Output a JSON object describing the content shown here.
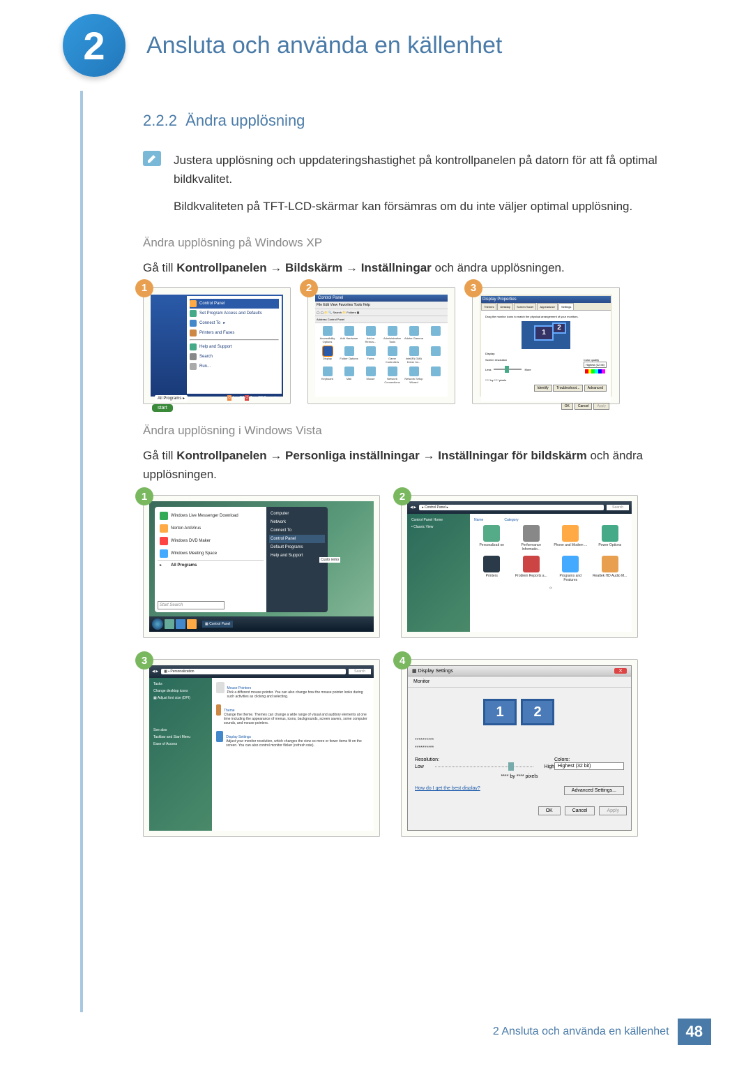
{
  "chapter": {
    "number": "2",
    "title": "Ansluta och använda en källenhet"
  },
  "section": {
    "number": "2.2.2",
    "title": "Ändra upplösning"
  },
  "intro": {
    "p1": "Justera upplösning och uppdateringshastighet på kontrollpanelen på datorn för att få optimal bildkvalitet.",
    "p2": "Bildkvaliteten på TFT-LCD-skärmar kan försämras om du inte väljer optimal upplösning."
  },
  "xp": {
    "heading": "Ändra upplösning på Windows XP",
    "path_pre": "Gå till ",
    "path_b1": "Kontrollpanelen",
    "path_b2": "Bildskärm",
    "path_b3": "Inställningar",
    "path_post": " och ändra upplösningen.",
    "menu": {
      "title": "Control Panel",
      "items": [
        "Set Program Access and Defaults",
        "Connect To",
        "Printers and Faxes",
        "Help and Support",
        "Search",
        "Run..."
      ],
      "all_programs": "All Programs",
      "logoff": "Log Off",
      "shutdown": "Turn Off Computer",
      "start": "start"
    },
    "cp": {
      "title": "Control Panel",
      "menus": "File  Edit  View  Favorites  Tools  Help",
      "addr": "Address  Control Panel",
      "items": [
        "Accessibility Options",
        "Add Hardware",
        "Add or Remov...",
        "Administrative Tools",
        "Adobe Gamma",
        "",
        "Display",
        "Folder Options",
        "Fonts",
        "Game Controllers",
        "Intel(R) GMA Driver for...",
        "",
        "Keyboard",
        "Mail",
        "Mouse",
        "Network Connections",
        "Network Setup Wizard",
        ""
      ]
    },
    "dp": {
      "title": "Display Properties",
      "tabs": [
        "Themes",
        "Desktop",
        "Screen Saver",
        "Appearance",
        "Settings"
      ],
      "drag": "Drag the monitor icons to match the physical arrangement of your monitors.",
      "mon1": "1",
      "mon2": "2",
      "display_label": "Display:",
      "res_label": "Screen resolution",
      "less": "Less",
      "more": "More",
      "colorq": "Color quality",
      "colorv": "Highest (32 bit)",
      "pixels": "**** by **** pixels",
      "btn_identify": "Identify",
      "btn_trouble": "Troubleshoot...",
      "btn_adv": "Advanced",
      "ok": "OK",
      "cancel": "Cancel",
      "apply": "Apply"
    }
  },
  "vista": {
    "heading": "Ändra upplösning i Windows Vista",
    "path_pre": "Gå till ",
    "path_b1": "Kontrollpanelen",
    "path_b2": "Personliga inställningar",
    "path_b3": "Inställningar för bildskärm",
    "path_post": " och ändra upplösningen.",
    "menu": {
      "items": [
        "Windows Live Messenger Download",
        "Norton AntiVirus",
        "Windows DVD Maker",
        "Windows Meeting Space",
        "All Programs"
      ],
      "right": [
        "Computer",
        "Network",
        "Connect To",
        "Control Panel",
        "Default Programs",
        "Help and Support"
      ],
      "custo": "Custo remo",
      "search": "Start Search",
      "tb": "Control Panel"
    },
    "cp": {
      "addr": "Control Panel",
      "search": "Search",
      "side_home": "Control Panel Home",
      "side_classic": "Classic View",
      "cols": [
        "Name",
        "Category"
      ],
      "items": [
        "Personalizati on",
        "Performance Informatio...",
        "Phone and Modem ...",
        "Power Options",
        "Printers",
        "Problem Reports a...",
        "Programs and Features",
        "Realtek HD Audio M..."
      ]
    },
    "pers": {
      "addr": "Personalization",
      "search": "Search",
      "side": {
        "tasks": "Tasks",
        "i1": "Change desktop icons",
        "i2": "Adjust font size (DPI)",
        "see": "See also",
        "i3": "Taskbar and Start Menu",
        "i4": "Ease of Access"
      },
      "main": {
        "mp_title": "Mouse Pointers",
        "mp_text": "Pick a different mouse pointer. You can also change how the mouse pointer looks during such activities as clicking and selecting.",
        "th_title": "Theme",
        "th_text": "Change the theme. Themes can change a wide range of visual and auditory elements at one time including the appearance of menus, icons, backgrounds, screen savers, some computer sounds, and mouse pointers.",
        "ds_title": "Display Settings",
        "ds_text": "Adjust your monitor resolution, which changes the view so more or fewer items fit on the screen. You can also control monitor flicker (refresh rate)."
      }
    },
    "ds": {
      "title": "Display Settings",
      "tab": "Monitor",
      "mon1": "1",
      "mon2": "2",
      "line1": "**********",
      "line2": "**********",
      "res": "Resolution:",
      "low": "Low",
      "high": "High",
      "colors": "Colors:",
      "colorv": "Highest (32 bit)",
      "pixels": "**** by **** pixels",
      "help": "How do I get the best display?",
      "adv": "Advanced Settings...",
      "ok": "OK",
      "cancel": "Cancel",
      "apply": "Apply"
    }
  },
  "footer": {
    "text": "2 Ansluta och använda en källenhet",
    "page": "48"
  }
}
